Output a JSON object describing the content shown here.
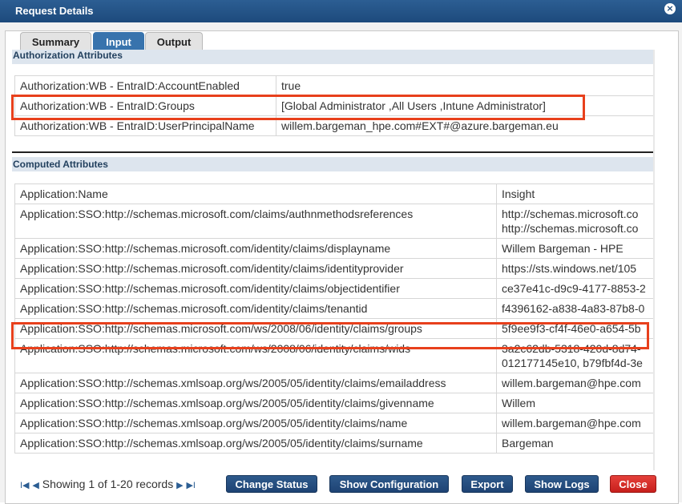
{
  "window": {
    "title": "Request Details",
    "close_glyph": "×"
  },
  "tabs": [
    {
      "label": "Summary",
      "active": false
    },
    {
      "label": "Input",
      "active": true
    },
    {
      "label": "Output",
      "active": false
    }
  ],
  "authorization": {
    "header": "Authorization Attributes",
    "rows": [
      {
        "name": "Authorization:WB - EntraID:AccountEnabled",
        "value": "true"
      },
      {
        "name": "Authorization:WB - EntraID:Groups",
        "value": "[Global Administrator ,All Users ,Intune Administrator]"
      },
      {
        "name": "Authorization:WB - EntraID:UserPrincipalName",
        "value": "willem.bargeman_hpe.com#EXT#@azure.bargeman.eu"
      }
    ]
  },
  "computed": {
    "header": "Computed Attributes",
    "rows": [
      {
        "name": "Application:Name",
        "value": "Insight",
        "value2": ""
      },
      {
        "name": "Application:SSO:http://schemas.microsoft.com/claims/authnmethodsreferences",
        "value": "http://schemas.microsoft.co",
        "value2": "http://schemas.microsoft.co"
      },
      {
        "name": "Application:SSO:http://schemas.microsoft.com/identity/claims/displayname",
        "value": "Willem Bargeman - HPE",
        "value2": ""
      },
      {
        "name": "Application:SSO:http://schemas.microsoft.com/identity/claims/identityprovider",
        "value": "https://sts.windows.net/105",
        "value2": ""
      },
      {
        "name": "Application:SSO:http://schemas.microsoft.com/identity/claims/objectidentifier",
        "value": "ce37e41c-d9c9-4177-8853-2",
        "value2": ""
      },
      {
        "name": "Application:SSO:http://schemas.microsoft.com/identity/claims/tenantid",
        "value": "f4396162-a838-4a83-87b8-0",
        "value2": ""
      },
      {
        "name": "Application:SSO:http://schemas.microsoft.com/ws/2008/06/identity/claims/groups",
        "value": "5f9ee9f3-cf4f-46e0-a654-5b",
        "value2": ""
      },
      {
        "name": "Application:SSO:http://schemas.microsoft.com/ws/2008/06/identity/claims/wids",
        "value": "3a2c62db-5318-420d-8d74-",
        "value2": "012177145e10, b79fbf4d-3e"
      },
      {
        "name": "Application:SSO:http://schemas.xmlsoap.org/ws/2005/05/identity/claims/emailaddress",
        "value": "willem.bargeman@hpe.com",
        "value2": ""
      },
      {
        "name": "Application:SSO:http://schemas.xmlsoap.org/ws/2005/05/identity/claims/givenname",
        "value": "Willem",
        "value2": ""
      },
      {
        "name": "Application:SSO:http://schemas.xmlsoap.org/ws/2005/05/identity/claims/name",
        "value": "willem.bargeman@hpe.com",
        "value2": ""
      },
      {
        "name": "Application:SSO:http://schemas.xmlsoap.org/ws/2005/05/identity/claims/surname",
        "value": "Bargeman",
        "value2": ""
      }
    ]
  },
  "footer": {
    "pager_text": "Showing 1 of 1-20 records",
    "first_glyph": "I◀",
    "prev_glyph": "◀",
    "next_glyph": "▶",
    "last_glyph": "▶I",
    "buttons": {
      "change_status": "Change Status",
      "show_configuration": "Show Configuration",
      "export": "Export",
      "show_logs": "Show Logs",
      "close": "Close"
    }
  },
  "colors": {
    "accent": "#3873ad",
    "title_bar": "#1d4a7c",
    "highlight_box": "#e8401c",
    "close_button": "#c71f1c"
  }
}
